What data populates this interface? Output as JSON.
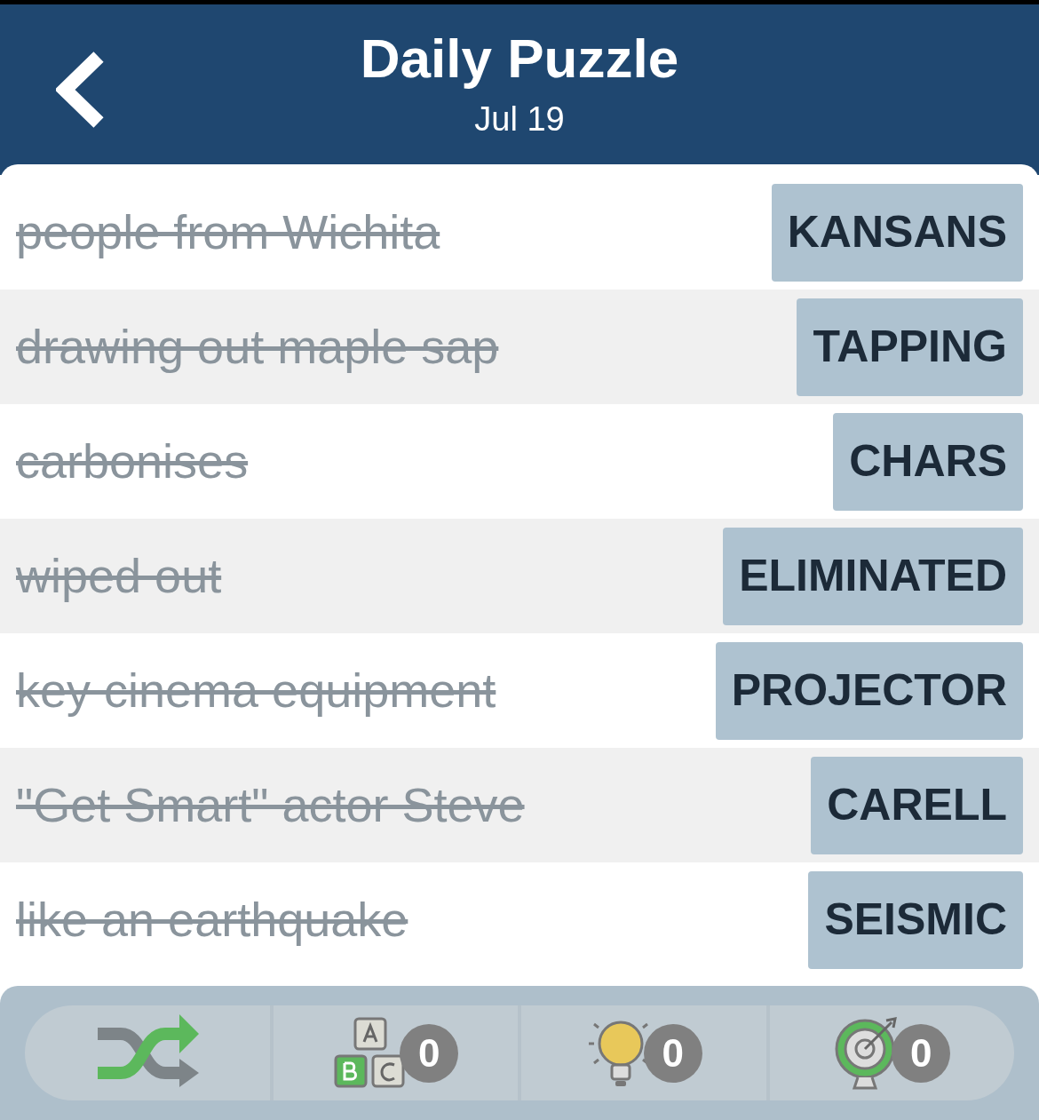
{
  "header": {
    "title": "Daily Puzzle",
    "subtitle": "Jul 19"
  },
  "clues": [
    {
      "clue": "people from Wichita",
      "answer": "KANSANS",
      "solved": true
    },
    {
      "clue": "drawing out maple sap",
      "answer": "TAPPING",
      "solved": true
    },
    {
      "clue": "carbonises",
      "answer": "CHARS",
      "solved": true
    },
    {
      "clue": "wiped out",
      "answer": "ELIMINATED",
      "solved": true
    },
    {
      "clue": "key cinema equipment",
      "answer": "PROJECTOR",
      "solved": true
    },
    {
      "clue": "\"Get Smart\" actor Steve",
      "answer": "CARELL",
      "solved": true
    },
    {
      "clue": "like an earthquake",
      "answer": "SEISMIC",
      "solved": true
    }
  ],
  "toolbar": [
    {
      "kind": "shuffle"
    },
    {
      "kind": "letters",
      "count": "0"
    },
    {
      "kind": "hint",
      "count": "0"
    },
    {
      "kind": "target",
      "count": "0"
    }
  ]
}
